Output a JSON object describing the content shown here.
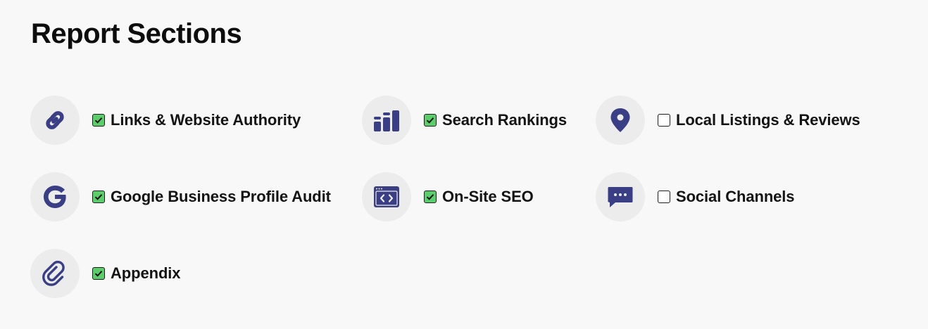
{
  "page": {
    "title": "Report Sections"
  },
  "colors": {
    "icon": "#3a3f85",
    "icon_bg": "#ececec",
    "checkbox_checked": "#5ccd6b"
  },
  "sections": [
    {
      "label": "Links & Website Authority",
      "checked": true,
      "icon": "link-icon"
    },
    {
      "label": "Search Rankings",
      "checked": true,
      "icon": "bar-chart-icon"
    },
    {
      "label": "Local Listings & Reviews",
      "checked": false,
      "icon": "map-pin-icon"
    },
    {
      "label": "Google Business Profile Audit",
      "checked": true,
      "icon": "google-icon"
    },
    {
      "label": "On-Site SEO",
      "checked": true,
      "icon": "code-window-icon"
    },
    {
      "label": "Social Channels",
      "checked": false,
      "icon": "chat-bubble-icon"
    },
    {
      "label": "Appendix",
      "checked": true,
      "icon": "paperclip-icon"
    }
  ]
}
